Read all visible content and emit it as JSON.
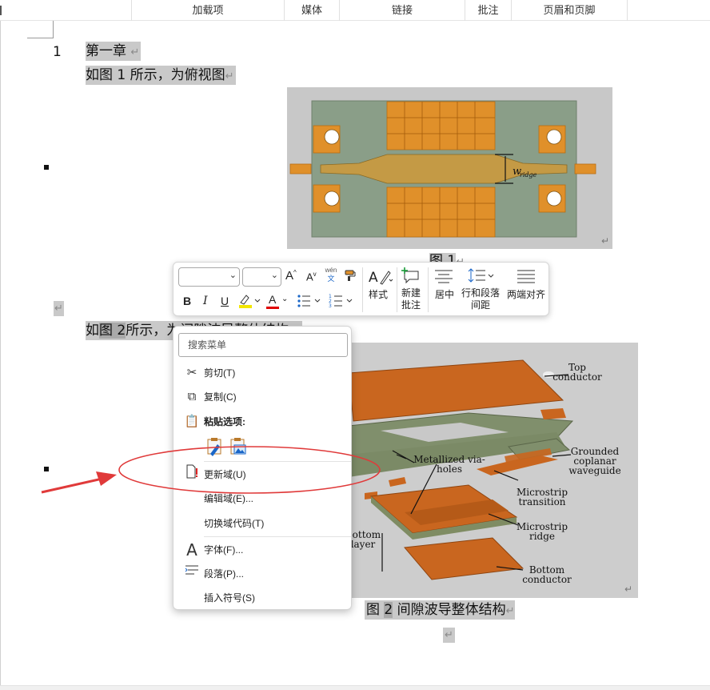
{
  "ribbon": {
    "groups": [
      {
        "label": "",
        "key": "g0"
      },
      {
        "label": "加载项",
        "key": "g1"
      },
      {
        "label": "媒体",
        "key": "g2"
      },
      {
        "label": "链接",
        "key": "g3"
      },
      {
        "label": "批注",
        "key": "g4"
      },
      {
        "label": "页眉和页脚",
        "key": "g5"
      }
    ]
  },
  "document": {
    "heading_number": "1",
    "heading_text": "第一章",
    "para1": "如图 1 所示，为俯视图",
    "para_mark": "↵",
    "caption1": "图 1",
    "para2_prefix": "如",
    "para2_field": "图 2",
    "para2_suffix": "所示，为间隙波导整体结构",
    "caption2_prefix": "图",
    "caption2_num": "2",
    "caption2_text": "间隙波导整体结构"
  },
  "figure1": {
    "label": "w",
    "label_sub": "ridge"
  },
  "figure2": {
    "labels": {
      "top": "Top",
      "top2": "conductor",
      "vias": "Metallized via-",
      "vias2": "holes",
      "gcpw1": "Grounded",
      "gcpw2": "coplanar",
      "gcpw3": "waveguide",
      "ms1": "Microstrip",
      "ms2": "transition",
      "ridge1": "Microstrip",
      "ridge2": "ridge",
      "bottom1": "Bottom",
      "bottom2": "conductor",
      "layer1": "Bottom",
      "layer2": "layer"
    }
  },
  "mini_toolbar": {
    "font_name": "",
    "font_size": "",
    "grow": "A",
    "shrink": "A",
    "pinyin_top": "wén",
    "pinyin_bottom": "文",
    "bold": "B",
    "italic": "I",
    "underline": "U",
    "font_color_letter": "A",
    "styles_label": "样式",
    "new_comment_label_1": "新建",
    "new_comment_label_2": "批注",
    "center_label": "居中",
    "spacing_label_1": "行和段落",
    "spacing_label_2": "间距",
    "justify_label": "两端对齐",
    "colors": {
      "highlight": "#f2e600",
      "font_color": "#e00000"
    }
  },
  "context_menu": {
    "search_placeholder": "搜索菜单",
    "cut": "剪切(T)",
    "copy": "复制(C)",
    "paste_options": "粘贴选项:",
    "update_field": "更新域(U)",
    "edit_field": "编辑域(E)...",
    "toggle_codes": "切换域代码(T)",
    "font": "字体(F)...",
    "paragraph": "段落(P)...",
    "insert_symbol": "插入符号(S)"
  },
  "annotation_color": "#e03a3a"
}
